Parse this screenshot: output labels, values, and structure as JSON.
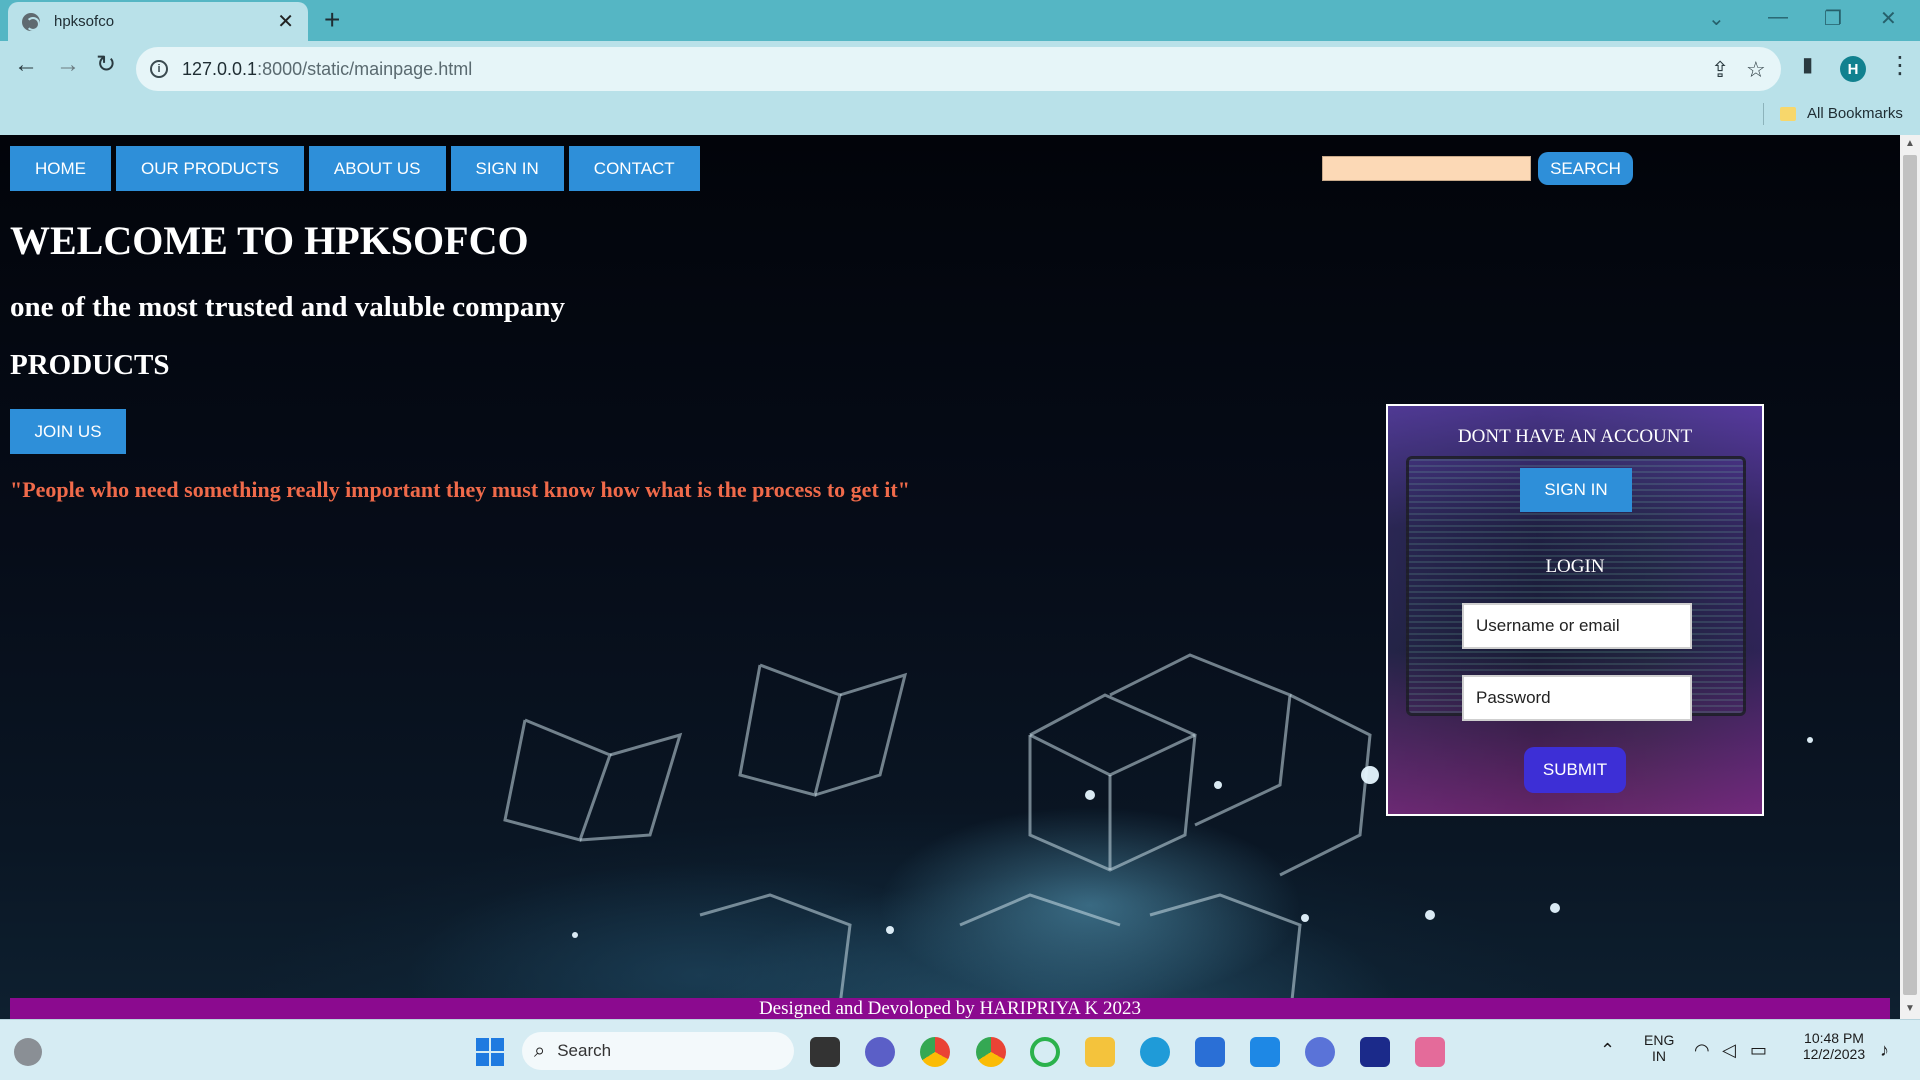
{
  "browser": {
    "tab_title": "hpksofco",
    "tab_close": "✕",
    "new_tab": "+",
    "url_host": "127.0.0.1",
    "url_rest": ":8000/static/mainpage.html",
    "profile_initial": "H",
    "bookmarks_label": "All Bookmarks"
  },
  "nav": {
    "home": "HOME",
    "products": "OUR PRODUCTS",
    "about": "ABOUT US",
    "signin": "SIGN IN",
    "contact": "CONTACT"
  },
  "search": {
    "placeholder": "",
    "button": "SEARCH"
  },
  "hero": {
    "welcome": "WELCOME TO HPKSOFCO",
    "tagline": "one of the most trusted and valuble company",
    "products": "PRODUCTS",
    "join_button": "JOIN US",
    "quote": "\"People who need something really important they must know how what is the process to get it\""
  },
  "login_panel": {
    "title": "DONT HAVE AN ACCOUNT",
    "signin_button": "SIGN IN",
    "login_heading": "LOGIN",
    "username_placeholder": "Username or email",
    "password_placeholder": "Password",
    "submit_button": "SUBMIT"
  },
  "footer": {
    "text": "Designed and Devoloped by HARIPRIYA K 2023"
  },
  "taskbar": {
    "search_label": "Search",
    "lang_top": "ENG",
    "lang_bottom": "IN",
    "time": "10:48 PM",
    "date": "12/2/2023"
  },
  "colors": {
    "nav_button": "#2e8fd9",
    "search_field": "#fcd9b6",
    "quote": "#f06a4a",
    "footer": "#8b0a8f",
    "submit": "#3d2fd6"
  }
}
